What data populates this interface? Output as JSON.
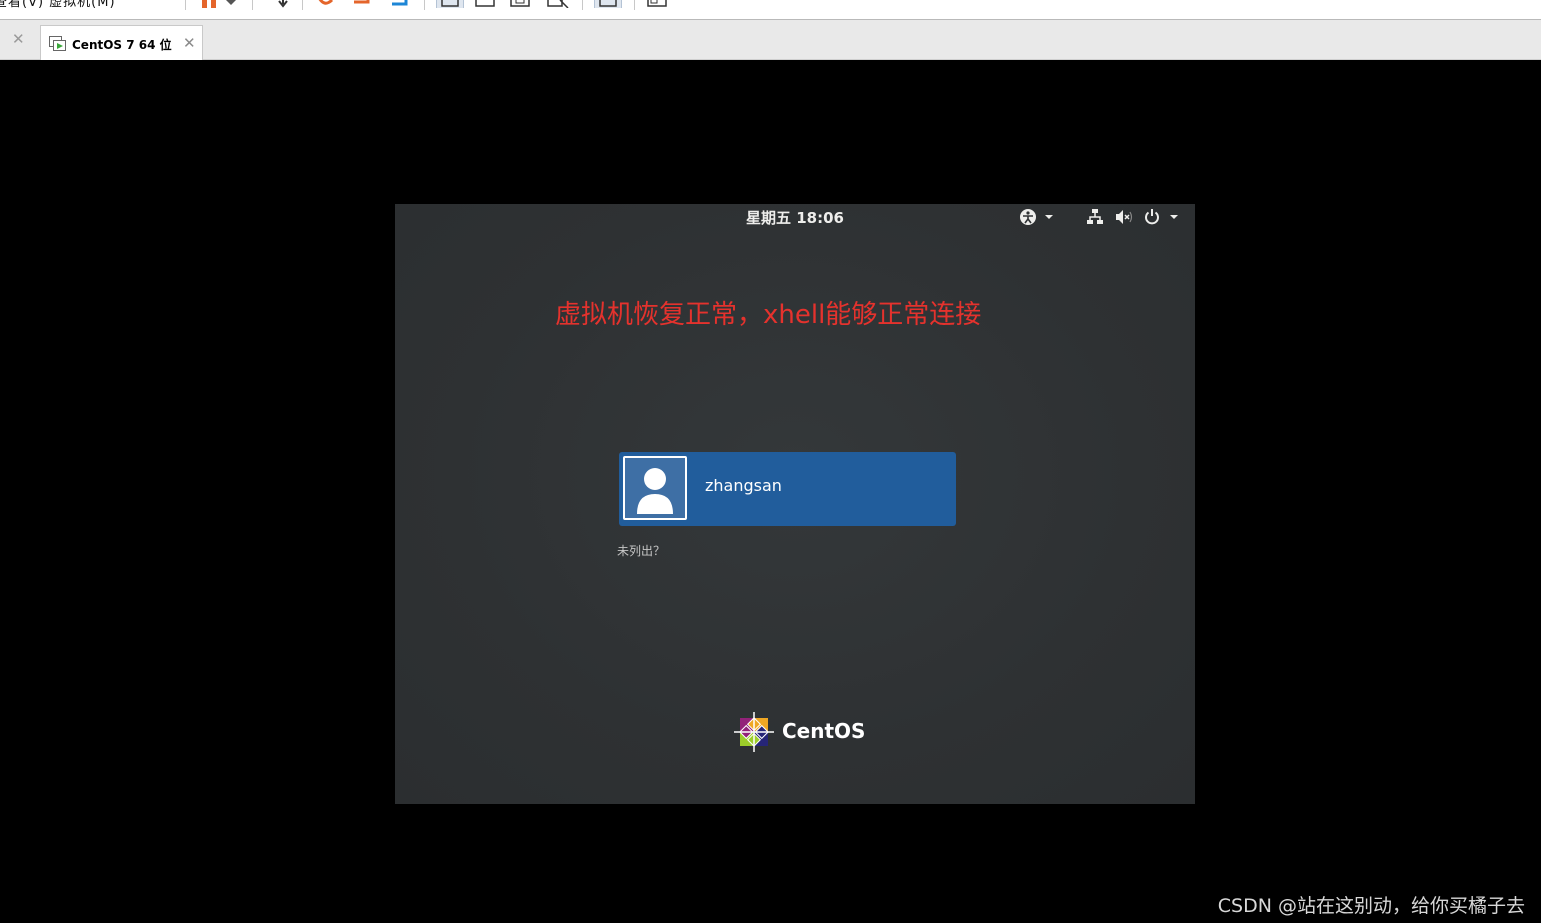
{
  "host": {
    "menu_fragment": "查看(V)  虚拟机(M)",
    "tab_bar": {
      "tab_label": "CentOS 7 64 位"
    }
  },
  "vm_screen": {
    "clock": "星期五 18:06",
    "annotation": "虚拟机恢复正常，xhell能够正常连接",
    "user": {
      "name": "zhangsan"
    },
    "not_listed": "未列出？",
    "brand": "CentOS",
    "tray_icons": [
      "accessibility-icon",
      "network-icon",
      "volume-muted-icon",
      "power-icon"
    ]
  },
  "watermark": "CSDN @站在这别动，给你买橘子去",
  "colors": {
    "annotation": "#e5322d",
    "user_card": "#215d9c",
    "vm_background": "#2e3133"
  }
}
